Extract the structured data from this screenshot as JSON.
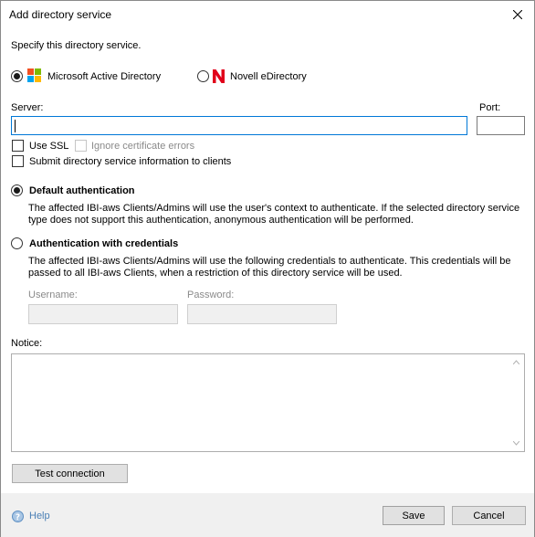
{
  "dialog": {
    "title": "Add directory service",
    "prompt": "Specify this directory service."
  },
  "directory_type": {
    "options": [
      {
        "label": "Microsoft Active Directory",
        "icon": "microsoft-logo-icon",
        "selected": true
      },
      {
        "label": "Novell eDirectory",
        "icon": "novell-logo-icon",
        "selected": false
      }
    ]
  },
  "server": {
    "label": "Server:",
    "value": "",
    "port_label": "Port:",
    "port_value": ""
  },
  "options": {
    "use_ssl": {
      "label": "Use SSL",
      "checked": false
    },
    "ignore_cert": {
      "label": "Ignore certificate errors",
      "checked": false,
      "enabled": false
    },
    "submit_info": {
      "label": "Submit directory service information to clients",
      "checked": false
    }
  },
  "auth": {
    "default": {
      "label": "Default authentication",
      "selected": true,
      "description": "The affected IBI-aws Clients/Admins will use the user's context to authenticate. If the selected directory service type does not support this authentication, anonymous authentication will be performed."
    },
    "credentials": {
      "label": "Authentication with credentials",
      "selected": false,
      "description": "The affected IBI-aws Clients/Admins will use the following credentials to authenticate. This credentials will be passed to all IBI-aws Clients, when a restriction of this directory service will be used.",
      "username_label": "Username:",
      "password_label": "Password:"
    }
  },
  "notice": {
    "label": "Notice:",
    "value": ""
  },
  "buttons": {
    "test_connection": "Test connection",
    "help": "Help",
    "save": "Save",
    "cancel": "Cancel"
  },
  "colors": {
    "accent": "#0078d7",
    "footer_bg": "#f0f0f0",
    "help_link": "#4a7fb5",
    "novell_red": "#e1001a"
  }
}
